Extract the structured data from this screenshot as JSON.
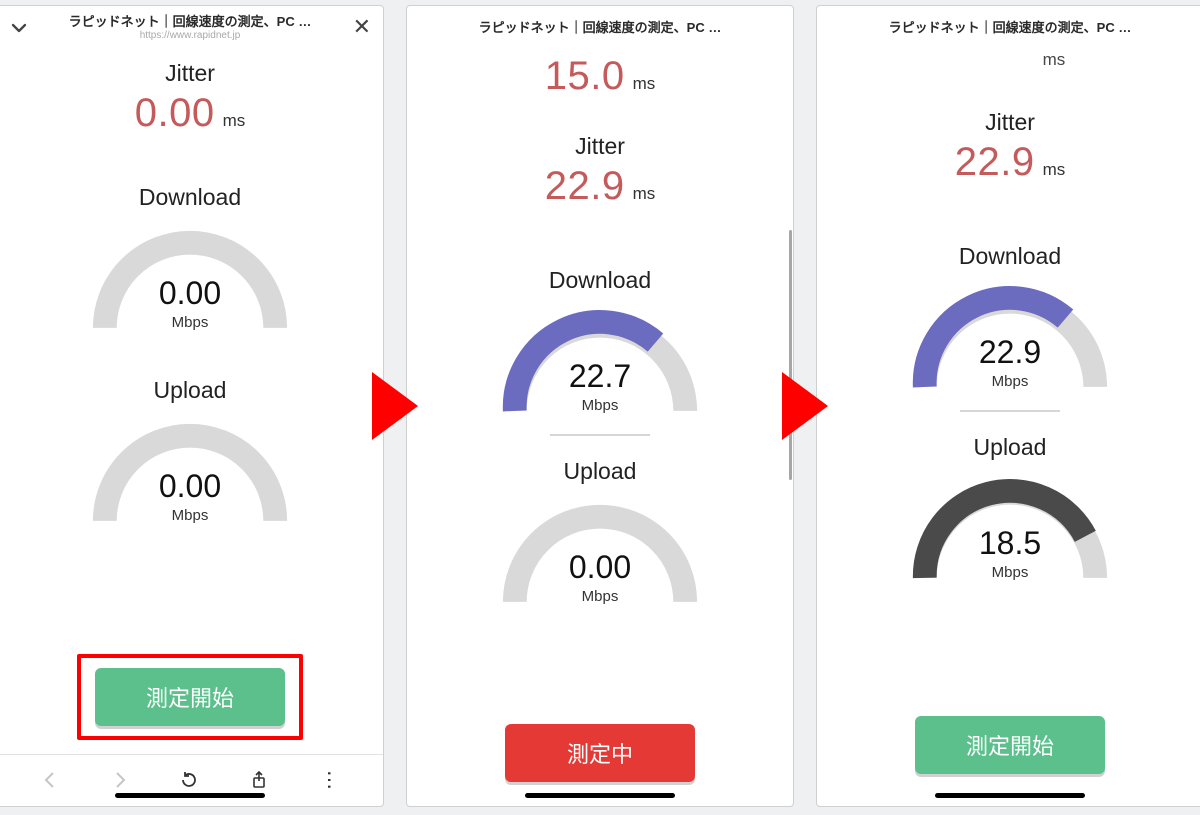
{
  "page_title": "ラピッドネット｜回線速度の測定、PC …",
  "page_url": "https://www.rapidnet.jp",
  "labels": {
    "jitter": "Jitter",
    "download": "Download",
    "upload": "Upload",
    "ms": "ms",
    "mbps": "Mbps"
  },
  "buttons": {
    "start": "測定開始",
    "measuring": "測定中"
  },
  "colors": {
    "rose": "#c55a5a",
    "gauge_track": "#d9d9d9",
    "gauge_fill_purple": "#6b6bbf",
    "gauge_fill_dark": "#4a4a4a",
    "green": "#5bc08c",
    "red": "#e53935",
    "highlight": "#ff0000"
  },
  "panels": [
    {
      "id": "initial",
      "jitter_value": "0.00",
      "download_value": "0.00",
      "download_fill_pct": 0,
      "download_fill_color": "none",
      "upload_value": "0.00",
      "upload_fill_pct": 0,
      "upload_fill_color": "none",
      "button_key": "start",
      "button_style": "green",
      "button_highlighted": true,
      "show_browser_chrome": true
    },
    {
      "id": "running",
      "ping_value": "15.0",
      "jitter_value": "22.9",
      "download_value": "22.7",
      "download_fill_pct": 68,
      "download_fill_color": "purple",
      "upload_value": "0.00",
      "upload_fill_pct": 0,
      "upload_fill_color": "none",
      "button_key": "measuring",
      "button_style": "red",
      "button_highlighted": false,
      "show_browser_chrome": false
    },
    {
      "id": "done",
      "ping_partial": true,
      "jitter_value": "22.9",
      "download_value": "22.9",
      "download_fill_pct": 68,
      "download_fill_color": "purple",
      "upload_value": "18.5",
      "upload_fill_pct": 82,
      "upload_fill_color": "dark",
      "button_key": "start",
      "button_style": "green",
      "button_highlighted": false,
      "show_browser_chrome": false
    }
  ]
}
